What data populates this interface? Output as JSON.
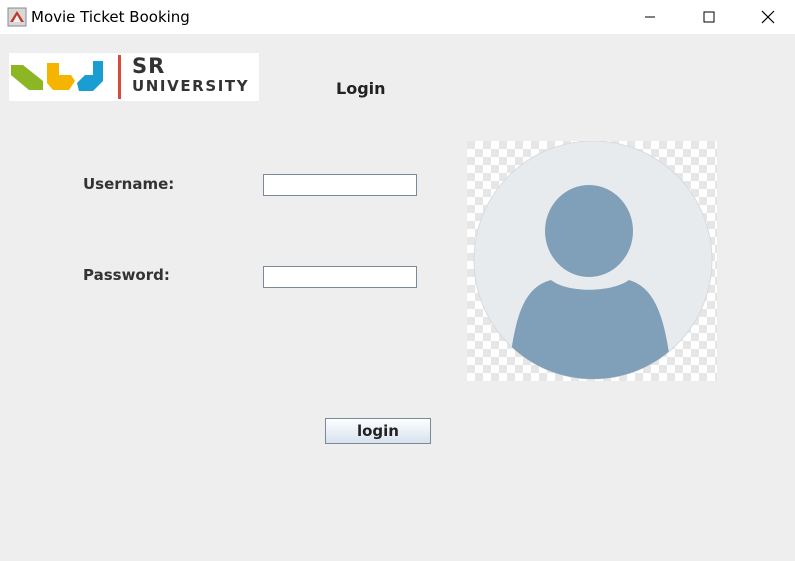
{
  "window": {
    "title": "Movie Ticket Booking",
    "controls": [
      "minimize",
      "maximize",
      "close"
    ]
  },
  "logo": {
    "line1": "SR",
    "line2": "UNIVERSITY",
    "colors": [
      "#8db624",
      "#f4b400",
      "#1a9ed1",
      "#d94a3b"
    ]
  },
  "form": {
    "heading": "Login",
    "username_label": "Username:",
    "username_value": "",
    "password_label": "Password:",
    "password_value": "",
    "submit_label": "login"
  },
  "avatar": {
    "icon": "user-avatar-icon",
    "fill_color": "#809fb8",
    "background_color": "#e8ebee"
  }
}
